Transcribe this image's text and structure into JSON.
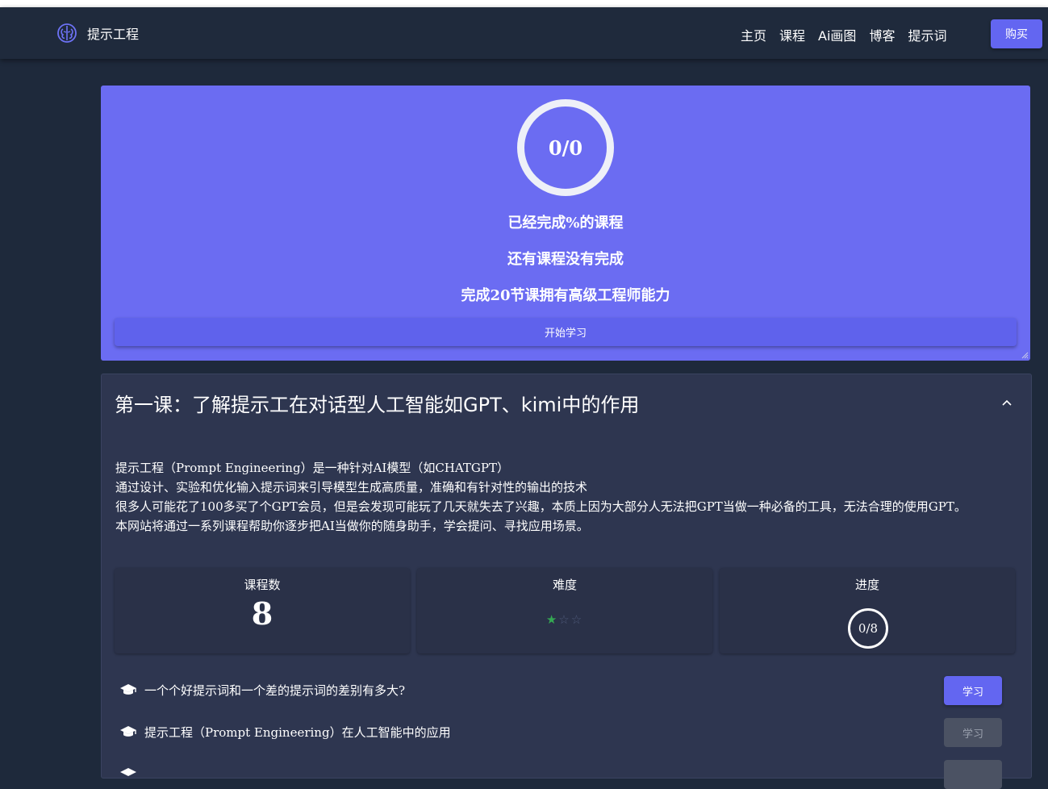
{
  "navbar": {
    "brand": "提示工程",
    "links": [
      "主页",
      "课程",
      "Ai画图",
      "博客",
      "提示词"
    ],
    "buy_label": "购买"
  },
  "progress": {
    "ring_text": "0/0",
    "line1": "已经完成%的课程",
    "line2": "还有课程没有完成",
    "line3": "完成20节课拥有高级工程师能力",
    "start_label": "开始学习"
  },
  "lesson": {
    "title": "第一课：了解提示工在对话型人工智能如GPT、kimi中的作用",
    "description": [
      "提示工程（Prompt Engineering）是一种针对AI模型（如CHATGPT）",
      "通过设计、实验和优化输入提示词来引导模型生成高质量，准确和有针对性的输出的技术",
      "很多人可能花了100多买了个GPT会员，但是会发现可能玩了几天就失去了兴趣，本质上因为大部分人无法把GPT当做一种必备的工具，无法合理的使用GPT。",
      "本网站将通过一系列课程帮助你逐步把AI当做你的随身助手，学会提问、寻找应用场景。"
    ],
    "stats": {
      "count_label": "课程数",
      "count_value": "8",
      "difficulty_label": "难度",
      "difficulty_rating": 1,
      "difficulty_max": 5,
      "progress_label": "进度",
      "progress_value": "0/8"
    },
    "items": [
      {
        "label": "一个个好提示词和一个差的提示词的差别有多大?",
        "button": "学习",
        "enabled": true
      },
      {
        "label": "提示工程（Prompt Engineering）在人工智能中的应用",
        "button": "学习",
        "enabled": false
      }
    ]
  },
  "colors": {
    "accent": "#6366f1",
    "progress_card": "#6b6cf2",
    "background": "#1e293b",
    "star_on": "#34a853"
  },
  "icons": {
    "brand": "brain-icon",
    "collapse": "chevron-up-icon",
    "lesson_row": "graduation-cap-icon"
  }
}
